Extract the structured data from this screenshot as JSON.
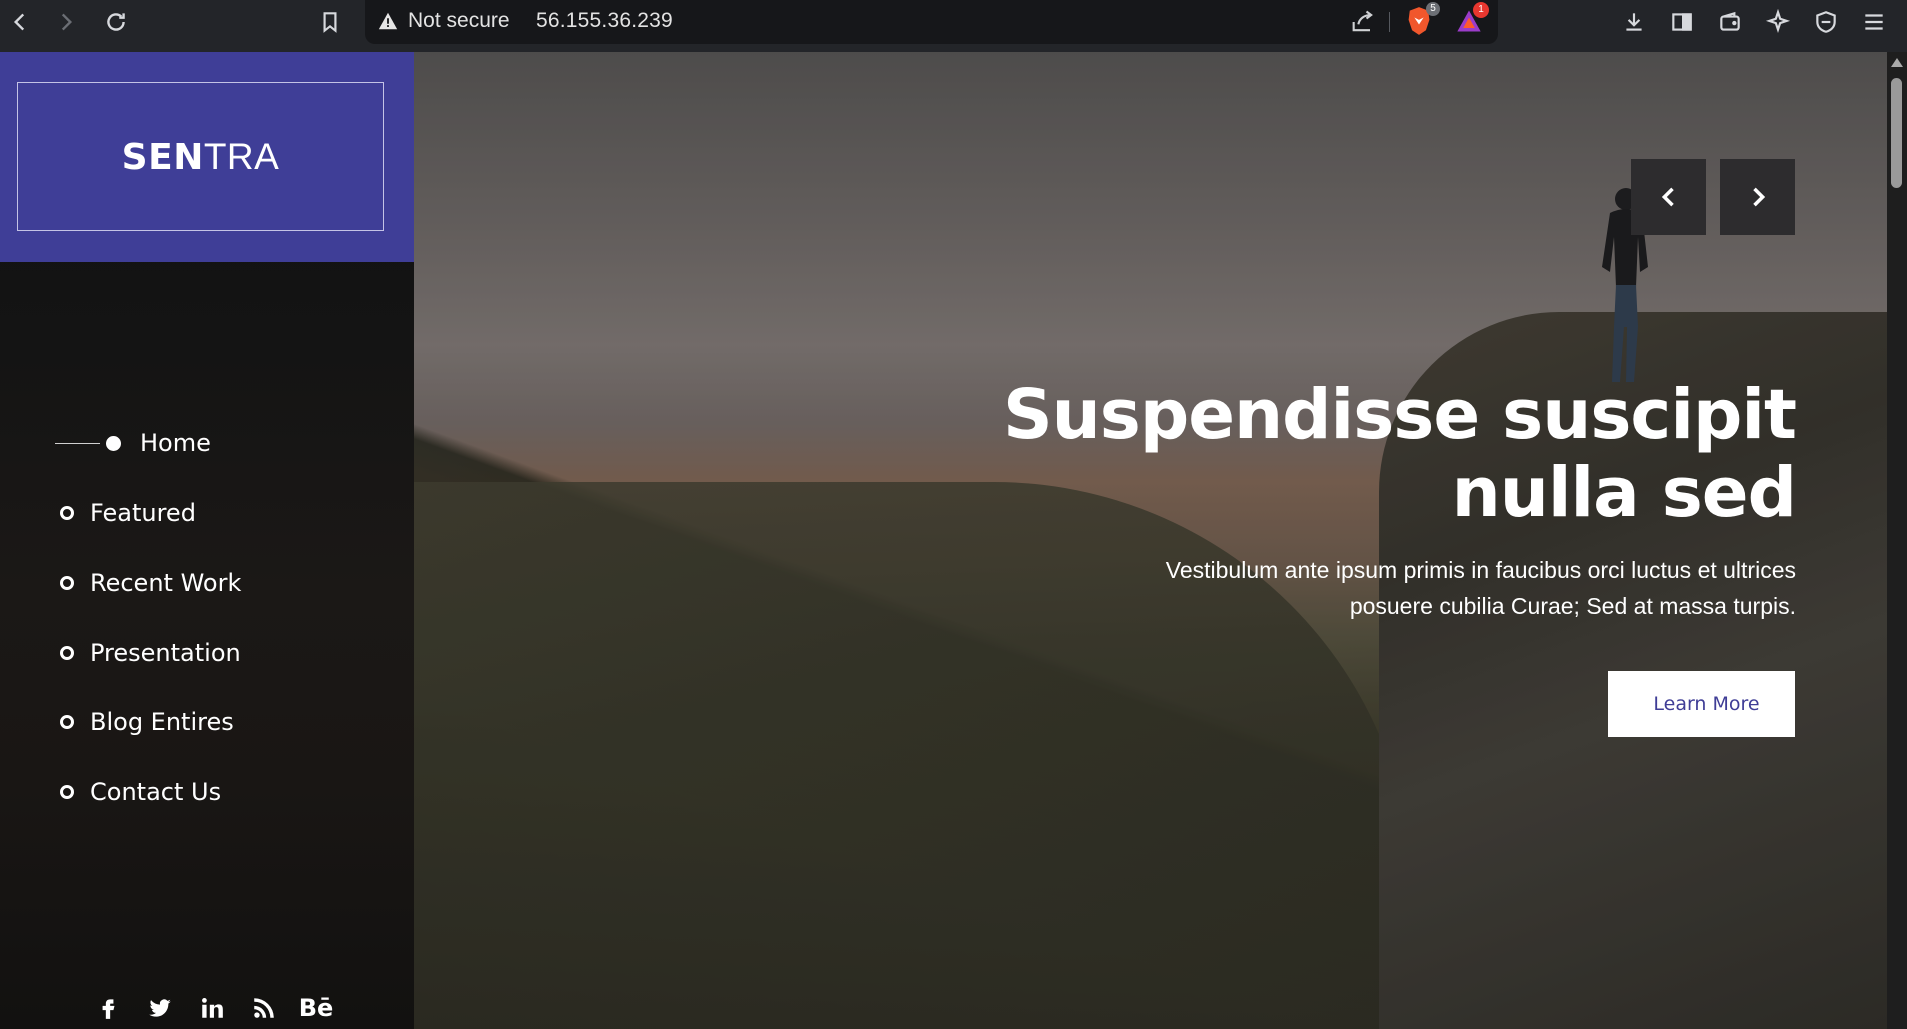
{
  "browser": {
    "security_label": "Not secure",
    "address": "56.155.36.239",
    "shield_badge": "5",
    "rewards_badge": "1",
    "icons": [
      "back-icon",
      "forward-icon",
      "reload-icon",
      "bookmark-icon",
      "warning-icon",
      "share-icon",
      "brave-shield-icon",
      "brave-rewards-icon",
      "download-icon",
      "sidebar-icon",
      "wallet-icon",
      "leo-icon",
      "vpn-icon",
      "menu-icon"
    ]
  },
  "sidebar": {
    "logo_strong": "SEN",
    "logo_light": "TRA",
    "nav": [
      {
        "label": "Home",
        "active": true
      },
      {
        "label": "Featured"
      },
      {
        "label": "Recent Work"
      },
      {
        "label": "Presentation"
      },
      {
        "label": "Blog Entires"
      },
      {
        "label": "Contact Us"
      }
    ],
    "socials": [
      "facebook-icon",
      "twitter-icon",
      "linkedin-icon",
      "rss-icon",
      "behance-icon"
    ],
    "behance_text": "Bē"
  },
  "hero": {
    "headline_line1": "Suspendisse suscipit",
    "headline_line2": "nulla sed",
    "subtext_line1": "Vestibulum ante ipsum primis in faucibus orci luctus et ultrices",
    "subtext_line2": "posuere cubilia Curae; Sed at massa turpis.",
    "cta_label": "Learn More",
    "prev_icon": "chevron-left-icon",
    "next_icon": "chevron-right-icon"
  },
  "colors": {
    "brand": "#3f3e97",
    "cta_text": "#3f3d96",
    "chrome_bg": "#232529",
    "sidebar_bg": "#141414"
  }
}
